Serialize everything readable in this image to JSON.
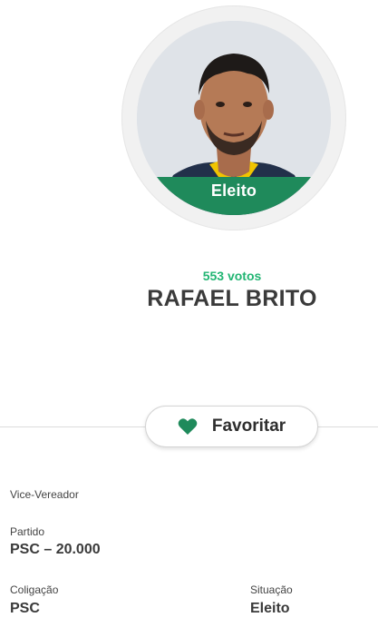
{
  "candidate": {
    "status_badge": "Eleito",
    "votes": "553 votos",
    "name": "RAFAEL BRITO"
  },
  "actions": {
    "favorite_label": "Favoritar",
    "favorite_icon": "heart-icon"
  },
  "details": {
    "role": "Vice-Vereador",
    "party_label": "Partido",
    "party_value": "PSC – 20.000",
    "coalition_label": "Coligação",
    "coalition_value": "PSC",
    "situation_label": "Situação",
    "situation_value": "Eleito"
  },
  "colors": {
    "accent_green": "#1f8a5b",
    "votes_green": "#22b573"
  }
}
